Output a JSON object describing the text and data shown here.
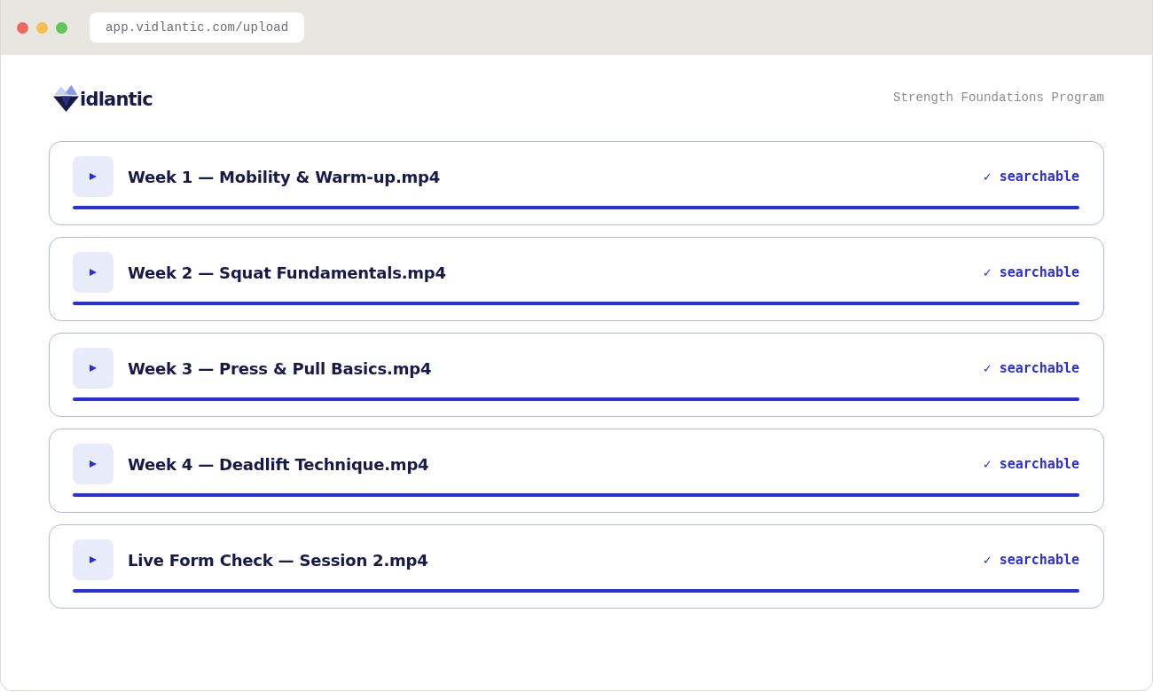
{
  "browser": {
    "url": "app.vidlantic.com/upload"
  },
  "header": {
    "logo_text": "idlantic",
    "program": "Strength Foundations Program"
  },
  "uploads": [
    {
      "title": "Week 1 — Mobility & Warm-up.mp4",
      "status": "✓ searchable",
      "level": 1
    },
    {
      "title": "Week 2 — Squat Fundamentals.mp4",
      "status": "✓ searchable",
      "level": 1
    },
    {
      "title": "Week 3 — Press & Pull Basics.mp4",
      "status": "✓ searchable",
      "level": 1
    },
    {
      "title": "Week 4 — Deadlift Technique.mp4",
      "status": "✓ searchable",
      "level": 1
    },
    {
      "title": "Live Form Check — Session 2.mp4",
      "status": "✓ searchable",
      "level": 1
    }
  ]
}
